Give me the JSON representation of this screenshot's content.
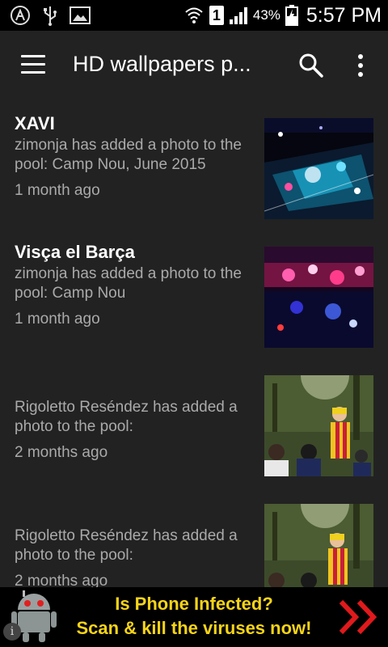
{
  "status_bar": {
    "battery_percent": "43%",
    "time": "5:57 PM",
    "sim_slot": "1",
    "icons": [
      "app-icon",
      "usb-icon",
      "image-icon",
      "wifi-icon",
      "sim-icon",
      "signal-icon",
      "battery-icon"
    ]
  },
  "app_bar": {
    "title": "HD wallpapers p...",
    "icons": [
      "menu-icon",
      "search-icon",
      "more-vert-icon"
    ]
  },
  "feed": {
    "items": [
      {
        "title": "XAVI",
        "description": "zimonja has added a photo to the pool: Camp Nou, June 2015",
        "time": "1 month ago"
      },
      {
        "title": "Visça el Barça",
        "description": "zimonja has added a photo to the pool: Camp Nou",
        "time": "1 month ago"
      },
      {
        "title": "",
        "description": "Rigoletto Reséndez has added a photo to the pool:",
        "time": "2 months ago"
      },
      {
        "title": "",
        "description": "Rigoletto Reséndez has added a photo to the pool:",
        "time": "2 months ago"
      }
    ]
  },
  "ad": {
    "headline": "Is Phone Infected?",
    "subline": "Scan & kill the viruses now!",
    "info_label": "i",
    "colors": {
      "text": "#f5d418",
      "arrows": "#e0191c",
      "background": "#000000"
    }
  },
  "colors": {
    "background": "#222222",
    "secondary_text": "#aaaaaa",
    "primary_text": "#ffffff"
  }
}
